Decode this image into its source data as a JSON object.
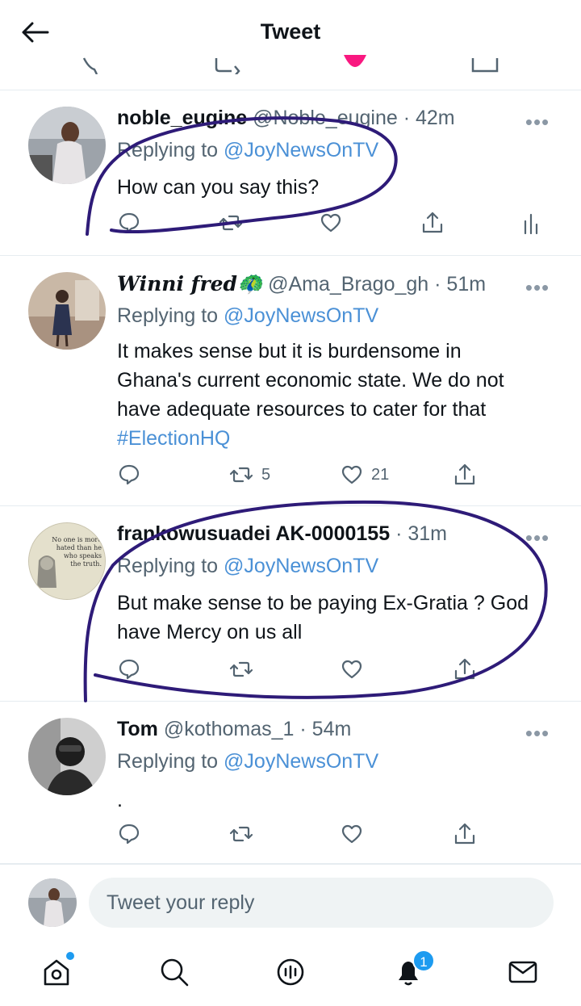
{
  "header": {
    "title": "Tweet"
  },
  "tweets": [
    {
      "name": "noble_eugine",
      "handle": "@Noble_eugine · 42m",
      "replying_prefix": "Replying to ",
      "replying_to": "@JoyNewsOnTV",
      "text": "How can you say this?",
      "hashtag": "",
      "retweets": "",
      "likes": ""
    },
    {
      "name": "Winni fred🦚",
      "handle": "@Ama_Brago_gh · 51m",
      "replying_prefix": "Replying to ",
      "replying_to": "@JoyNewsOnTV",
      "text": "It makes sense but it is burdensome in Ghana's current economic state. We do not have adequate resources to cater for that ",
      "hashtag": "#ElectionHQ",
      "retweets": "5",
      "likes": "21"
    },
    {
      "name": "frankowusuadei AK-0000155",
      "handle": "· 31m",
      "replying_prefix": "Replying to ",
      "replying_to": "@JoyNewsOnTV",
      "text": "But make sense to be paying Ex-Gratia ? God have Mercy on us all",
      "hashtag": "",
      "retweets": "",
      "likes": "",
      "avatar_text": "No one is more hated than he who speaks the truth."
    },
    {
      "name": "Tom",
      "handle": "@kothomas_1 · 54m",
      "replying_prefix": "Replying to ",
      "replying_to": "@JoyNewsOnTV",
      "text": ".",
      "hashtag": "",
      "retweets": "",
      "likes": ""
    }
  ],
  "reply": {
    "placeholder": "Tweet your reply"
  },
  "tabbar": {
    "notifications_badge": "1"
  },
  "colors": {
    "link": "#4a90d6",
    "accent": "#1d9bf0",
    "annotation_ink": "#2e1b78"
  }
}
